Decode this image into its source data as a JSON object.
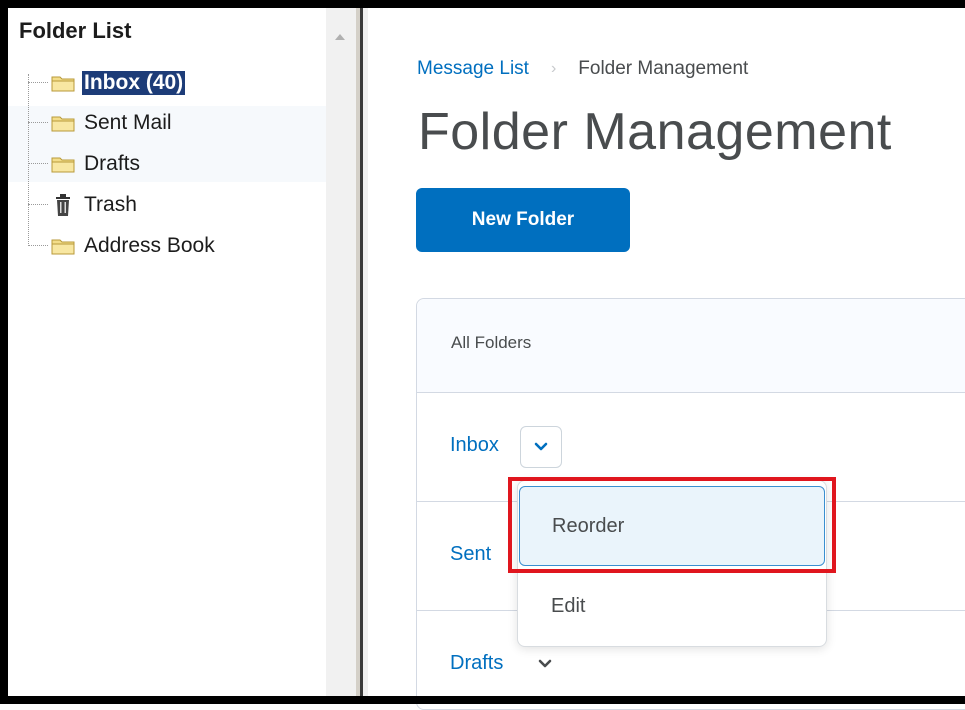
{
  "tree": {
    "title": "Folder List",
    "items": [
      {
        "label": "Inbox (40)",
        "icon": "folder-icon",
        "selected": true
      },
      {
        "label": "Sent Mail",
        "icon": "folder-icon"
      },
      {
        "label": "Drafts",
        "icon": "folder-icon"
      },
      {
        "label": "Trash",
        "icon": "trash-icon"
      },
      {
        "label": "Address Book",
        "icon": "folder-icon"
      }
    ]
  },
  "breadcrumb": {
    "link": "Message List",
    "separator": "›",
    "current": "Folder Management"
  },
  "page_title": "Folder Management",
  "new_folder_label": "New Folder",
  "table": {
    "header": "All Folders",
    "rows": [
      {
        "label": "Inbox"
      },
      {
        "label": "Sent"
      },
      {
        "label": "Drafts"
      }
    ]
  },
  "menu": {
    "items": [
      {
        "label": "Reorder",
        "highlighted": true
      },
      {
        "label": "Edit"
      }
    ]
  },
  "colors": {
    "accent": "#006fbf",
    "selection": "#1d3c78",
    "highlight_box": "#e0161e"
  }
}
